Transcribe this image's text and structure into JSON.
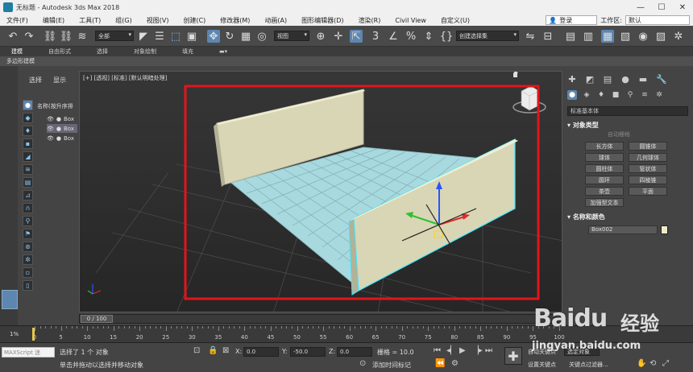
{
  "window": {
    "title": "无标题 - Autodesk 3ds Max 2018",
    "minimize": "—",
    "maximize": "☐",
    "close": "✕"
  },
  "menu": [
    "文件(F)",
    "编辑(E)",
    "工具(T)",
    "组(G)",
    "视图(V)",
    "创建(C)",
    "修改器(M)",
    "动画(A)",
    "图形编辑器(D)",
    "渲染(R)",
    "Civil View",
    "自定义(U)"
  ],
  "menu_right": {
    "login": "登录",
    "workspace_label": "工作区:",
    "workspace_value": "默认"
  },
  "toolbar": {
    "filter_dropdown": "全部",
    "view_dropdown": "视图",
    "selection_set": "创建选择集"
  },
  "ribbon": {
    "tabs": [
      "建模",
      "自由形式",
      "选择",
      "对象绘制",
      "填充"
    ],
    "subtitle": "多边形建模"
  },
  "scene_explorer": {
    "tabs": [
      "选择",
      "显示"
    ],
    "column_header": "名称(按升序排",
    "rows": [
      {
        "name": "Box",
        "selected": false
      },
      {
        "name": "Box",
        "selected": true
      },
      {
        "name": "Box",
        "selected": false
      }
    ]
  },
  "viewport": {
    "label": "[+] [透视] [标准] [默认明暗处理]",
    "highlight_color": "#e3141b"
  },
  "command_panel": {
    "primitive_dropdown": "标准基本体",
    "object_type_title": "对象类型",
    "auto_grid": "自动栅格",
    "buttons": [
      "长方体",
      "圆锥体",
      "球体",
      "几何球体",
      "圆柱体",
      "管状体",
      "圆环",
      "四棱锥",
      "茶壶",
      "平面",
      "加强型文本"
    ],
    "name_color_title": "名称和颜色",
    "object_name": "Box002",
    "object_color": "#efebc8"
  },
  "timeline": {
    "frame_display": "0 / 100",
    "ticks": [
      0,
      5,
      10,
      15,
      20,
      25,
      30,
      35,
      40,
      45,
      50,
      55,
      60,
      65,
      70,
      75,
      80,
      85,
      90,
      95,
      100
    ],
    "progress_label": "1%"
  },
  "status": {
    "maxscript": "MAXScript 迷",
    "selected_text": "选择了 1 个 对象",
    "hint_text": "单击并拖动以选择并移动对象",
    "x_value": "0.0",
    "y_value": "-50.0",
    "z_value": "0.0",
    "grid_text": "栅格 = 10.0",
    "add_time_tag": "添加时间标记",
    "auto_key": "自动关键点",
    "set_key": "设置关键点",
    "key_filter": "关键点过滤器...",
    "selected_obj": "选定对象"
  },
  "watermark": {
    "logo_text": "Baidu",
    "logo_cn": "经验",
    "url": "jingyan.baidu.com"
  }
}
